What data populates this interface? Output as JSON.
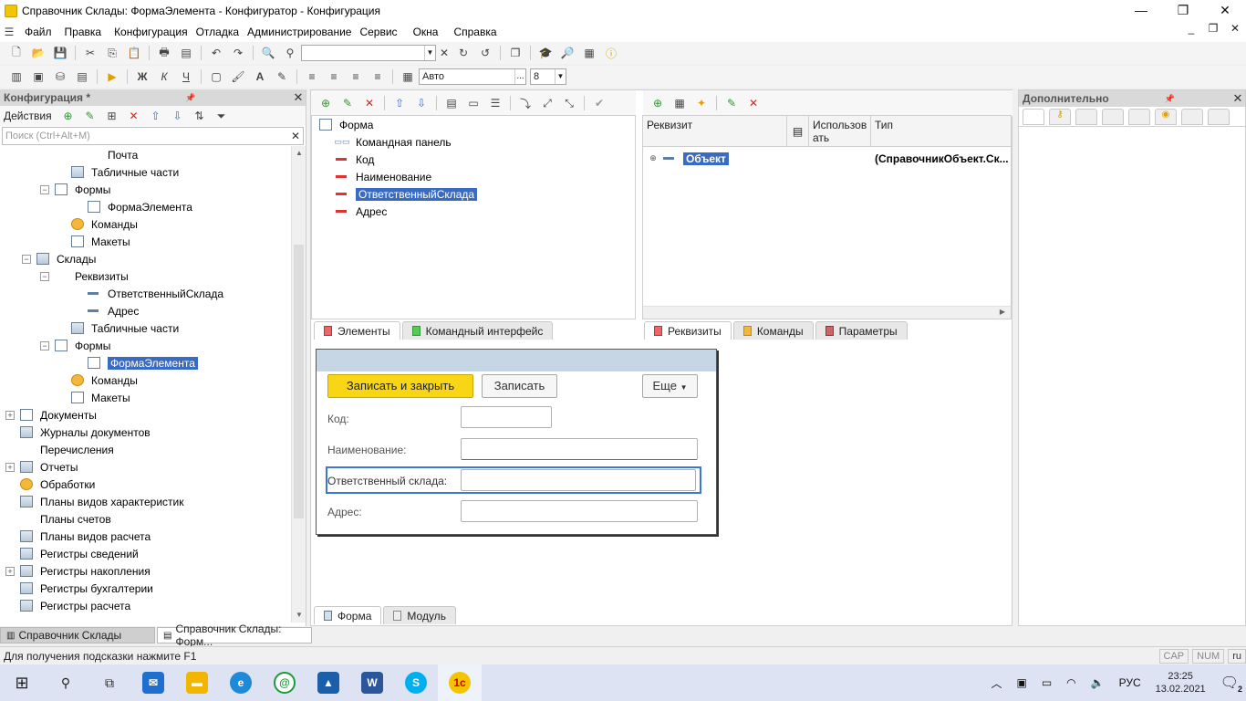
{
  "window": {
    "title": "Справочник Склады: ФормаЭлемента - Конфигуратор - Конфигурация",
    "minimize": "—",
    "maximize": "❐",
    "close": "✕"
  },
  "menu": {
    "items": [
      "Файл",
      "Правка",
      "Конфигурация",
      "Отладка",
      "Администрирование",
      "Сервис",
      "Окна",
      "Справка"
    ],
    "sys_min": "_",
    "sys_restore": "❐",
    "sys_close": "✕"
  },
  "toolbar2": {
    "font_value": "Авто",
    "font_more": "...",
    "size_value": "8"
  },
  "left_panel": {
    "title": "Конфигурация *",
    "close": "✕",
    "actions_label": "Действия",
    "search_placeholder": "Поиск (Ctrl+Alt+M)",
    "search_clear": "✕",
    "tree": [
      {
        "label": "Почта",
        "indent": 4,
        "icon": "none"
      },
      {
        "label": "Табличные части",
        "indent": 3,
        "icon": "table"
      },
      {
        "label": "Формы",
        "indent": 2,
        "icon": "form",
        "expander": "⊟"
      },
      {
        "label": "ФормаЭлемента",
        "indent": 4,
        "icon": "form"
      },
      {
        "label": "Команды",
        "indent": 3,
        "icon": "cmd"
      },
      {
        "label": "Макеты",
        "indent": 3,
        "icon": "form"
      },
      {
        "label": "Склады",
        "indent": 1,
        "icon": "table",
        "expander": "⊟"
      },
      {
        "label": "Реквизиты",
        "indent": 2,
        "icon": "none",
        "expander": "⊟"
      },
      {
        "label": "ОтветственныйСклада",
        "indent": 4,
        "icon": "dash"
      },
      {
        "label": "Адрес",
        "indent": 4,
        "icon": "dash"
      },
      {
        "label": "Табличные части",
        "indent": 3,
        "icon": "table"
      },
      {
        "label": "Формы",
        "indent": 2,
        "icon": "form",
        "expander": "⊟"
      },
      {
        "label": "ФормаЭлемента",
        "indent": 4,
        "icon": "form",
        "selected": true
      },
      {
        "label": "Команды",
        "indent": 3,
        "icon": "cmd"
      },
      {
        "label": "Макеты",
        "indent": 3,
        "icon": "form"
      },
      {
        "label": "Документы",
        "indent": 0,
        "icon": "form",
        "expander": "⊞"
      },
      {
        "label": "Журналы документов",
        "indent": 0,
        "icon": "table"
      },
      {
        "label": "Перечисления",
        "indent": 0,
        "icon": "none"
      },
      {
        "label": "Отчеты",
        "indent": 0,
        "icon": "table",
        "expander": "⊞"
      },
      {
        "label": "Обработки",
        "indent": 0,
        "icon": "cmd"
      },
      {
        "label": "Планы видов характеристик",
        "indent": 0,
        "icon": "table"
      },
      {
        "label": "Планы счетов",
        "indent": 0,
        "icon": "none"
      },
      {
        "label": "Планы видов расчета",
        "indent": 0,
        "icon": "table"
      },
      {
        "label": "Регистры сведений",
        "indent": 0,
        "icon": "table"
      },
      {
        "label": "Регистры накопления",
        "indent": 0,
        "icon": "table",
        "expander": "⊞"
      },
      {
        "label": "Регистры бухгалтерии",
        "indent": 0,
        "icon": "table"
      },
      {
        "label": "Регистры расчета",
        "indent": 0,
        "icon": "table"
      }
    ]
  },
  "elements": {
    "root": "Форма",
    "items": [
      {
        "label": "Командная панель",
        "icon": "panel"
      },
      {
        "label": "Код",
        "icon": "red"
      },
      {
        "label": "Наименование",
        "icon": "red"
      },
      {
        "label": "ОтветственныйСклада",
        "icon": "red",
        "selected": true
      },
      {
        "label": "Адрес",
        "icon": "red"
      }
    ],
    "tabs": [
      "Элементы",
      "Командный интерфейс"
    ]
  },
  "requisites": {
    "col_req": "Реквизит",
    "col_use": "Использовать",
    "col_use_l1": "Использов",
    "col_use_l2": "ать",
    "col_type": "Тип",
    "row_name": "Объект",
    "row_type": "(СправочникОбъект.Ск...",
    "tabs": [
      "Реквизиты",
      "Команды",
      "Параметры"
    ]
  },
  "preview": {
    "save_close": "Записать и закрыть",
    "save": "Записать",
    "more": "Еще",
    "fields": [
      "Код:",
      "Наименование:",
      "Ответственный склада:",
      "Адрес:"
    ]
  },
  "bottom_tabs": [
    "Форма",
    "Модуль"
  ],
  "right_panel": {
    "title": "Дополнительно",
    "close": "✕"
  },
  "window_tabs": [
    "Справочник Склады",
    "Справочник Склады: Форм..."
  ],
  "status": {
    "hint": "Для получения подсказки нажмите F1",
    "cap": "CAP",
    "num": "NUM",
    "lang": "ru"
  },
  "taskbar": {
    "lang": "РУС",
    "time": "23:25",
    "date": "13.02.2021",
    "notif": "2"
  }
}
